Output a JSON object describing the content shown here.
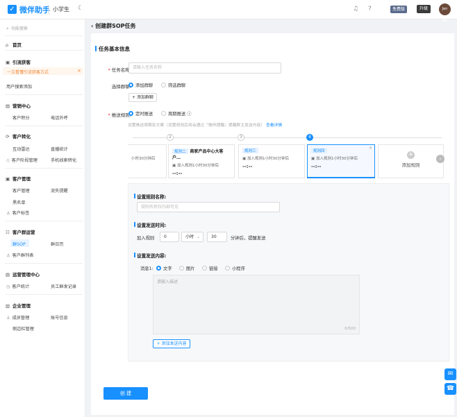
{
  "header": {
    "brand": "微伴助手",
    "school": "小学生",
    "moon_icon": "moon-icon",
    "vip_label": "免费版",
    "upgrade_label": "升级",
    "avatar_text": "Jen Wu"
  },
  "sidebar": {
    "search_placeholder": "功能搜索",
    "home": "首页",
    "groups": {
      "acquire": "引流获客",
      "marketing": "营销中心",
      "convert": "客户转化",
      "customer_mgmt": "客户管理",
      "group_ops": "客户群运营",
      "ops_center": "运营管理中心",
      "enterprise": "企业管理"
    },
    "items": {
      "highlight": "一文看懂引流获客方式",
      "user_search": "用户搜索添加",
      "points": "客户积分",
      "phone_call": "电话外呼",
      "interact_radar": "互动雷达",
      "live_stats": "直播统计",
      "stage_mgmt": "客户阶段管理",
      "phone_convert": "手机线索转化",
      "customer_mgmt": "客户管理",
      "churn": "流失提醒",
      "blacklist": "黑名单",
      "customer_tags": "客户标签",
      "group_sop": "群SOP",
      "group_calendar": "群日历",
      "group_list": "客户群列表",
      "customer_stats": "客户统计",
      "staff_records": "员工群发记录",
      "staff_mgmt": "成员管理",
      "account_info": "账号信息",
      "sidebar_bar": "侧边栏管理"
    }
  },
  "page": {
    "back_title": "创建群SOP任务",
    "section_title": "任务基本信息"
  },
  "form": {
    "task_name_label": "任务名称:",
    "task_name_placeholder": "请输入任务名称",
    "select_group_label": "选择群聊:",
    "group_opt_add": "添加群聊",
    "group_opt_filter": "筛选群聊",
    "add_group_btn": "+ 添加群聊",
    "push_rule_label": "推送规则:",
    "push_opt_timed": "定时推送",
    "push_opt_periodic": "周期推送 ⓘ",
    "tip_text": "设置推送周期及文案（设置规则后将会通过『微伴提醒』提醒群主发送内容）",
    "tip_link": "查看详情"
  },
  "steps": [
    "2",
    "3",
    "4"
  ],
  "rules": [
    {
      "tag": "规则二",
      "name": "商家产品中心大客户…",
      "line": "加入规则1小时30分钟后",
      "time": "--:--"
    },
    {
      "tag": "规则三",
      "name": "",
      "line": "加入规则1小时30分钟后",
      "time": "--:--"
    },
    {
      "tag": "规则四",
      "name": "",
      "line": "加入规则1小时30分钟后",
      "time": "--:--"
    }
  ],
  "partial_rule_line": "小时30分钟后",
  "add_rule_label": "添加规则",
  "rule_panel": {
    "name_title": "设置规则名称:",
    "name_placeholder": "规则名称仅内部可见",
    "time_title": "设置发送时间:",
    "join_label": "加入规则",
    "join_value": "0",
    "unit": "小时",
    "minutes": "30",
    "after_text": "分钟后，提醒发送",
    "content_title": "设置发送内容:",
    "msg_label": "消息1:",
    "types": [
      "文字",
      "图片",
      "链接",
      "小程序"
    ],
    "text_placeholder": "请输入描述",
    "counter": "0/500",
    "add_content": "+ 添加发送内容"
  },
  "create_label": "创 建"
}
